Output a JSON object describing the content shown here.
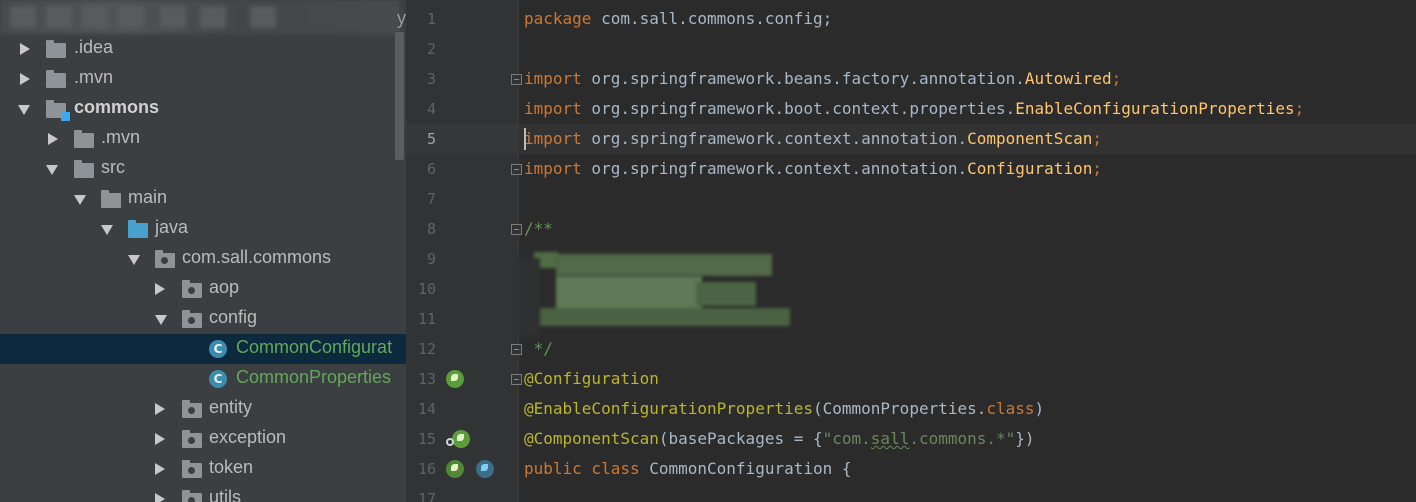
{
  "project_tree": {
    "header_trailing": "y",
    "rows": [
      {
        "label": ".idea",
        "kind": "folder",
        "expanded": false,
        "selected": false
      },
      {
        "label": ".mvn",
        "kind": "folder",
        "expanded": false,
        "selected": false
      },
      {
        "label": "commons",
        "kind": "module",
        "expanded": true,
        "selected": false
      },
      {
        "label": ".mvn",
        "kind": "folder",
        "expanded": false,
        "selected": false
      },
      {
        "label": "src",
        "kind": "folder",
        "expanded": true,
        "selected": false
      },
      {
        "label": "main",
        "kind": "folder",
        "expanded": true,
        "selected": false
      },
      {
        "label": "java",
        "kind": "source-root",
        "expanded": true,
        "selected": false
      },
      {
        "label": "com.sall.commons",
        "kind": "package",
        "expanded": true,
        "selected": false
      },
      {
        "label": "aop",
        "kind": "package",
        "expanded": false,
        "selected": false
      },
      {
        "label": "config",
        "kind": "package",
        "expanded": true,
        "selected": false
      },
      {
        "label": "CommonConfigurat",
        "kind": "class",
        "selected": true
      },
      {
        "label": "CommonProperties",
        "kind": "class",
        "selected": false
      },
      {
        "label": "entity",
        "kind": "package",
        "expanded": false,
        "selected": false
      },
      {
        "label": "exception",
        "kind": "package",
        "expanded": false,
        "selected": false
      },
      {
        "label": "token",
        "kind": "package",
        "expanded": false,
        "selected": false
      },
      {
        "label": "utils",
        "kind": "package",
        "expanded": false,
        "selected": false
      }
    ],
    "class_icon_letter": "C"
  },
  "editor": {
    "current_line": 5,
    "line_numbers": [
      "1",
      "2",
      "3",
      "4",
      "5",
      "6",
      "7",
      "8",
      "9",
      "10",
      "11",
      "12",
      "13",
      "14",
      "15",
      "16",
      "17"
    ],
    "lines": {
      "l1": {
        "kw": "package",
        "rest": " com.sall.commons.config;"
      },
      "l3": {
        "kw": "import",
        "pkg": " org.springframework.beans.factory.annotation.",
        "cls": "Autowired",
        "end": ";"
      },
      "l4": {
        "kw": "import",
        "pkg": " org.springframework.boot.context.properties.",
        "cls": "EnableConfigurationProperties",
        "end": ";"
      },
      "l5": {
        "kw": "import",
        "pkg": " org.springframework.context.annotation.",
        "cls": "ComponentScan",
        "end": ";"
      },
      "l6": {
        "kw": "import",
        "pkg": " org.springframework.context.annotation.",
        "cls": "Configuration",
        "end": ";"
      },
      "l8": {
        "doc": "/**"
      },
      "l12": {
        "doc": " */"
      },
      "l13": {
        "ann": "@Configuration"
      },
      "l14": {
        "ann": "@EnableConfigurationProperties",
        "open": "(CommonProperties.",
        "kw": "class",
        "close": ")"
      },
      "l15": {
        "ann": "@ComponentScan",
        "open": "(basePackages = {",
        "str_a": "\"com.",
        "str_b": "sall",
        "str_c": ".commons.*\"",
        "close": "})"
      },
      "l16": {
        "kw1": "public",
        "kw2": " class",
        "rest": " CommonConfiguration {"
      }
    }
  },
  "colors": {
    "keyword": "#cc7832",
    "class_name": "#ffc66d",
    "annotation": "#bbb529",
    "string": "#6a8759",
    "doc_comment": "#629755",
    "selection": "#0d293e"
  }
}
